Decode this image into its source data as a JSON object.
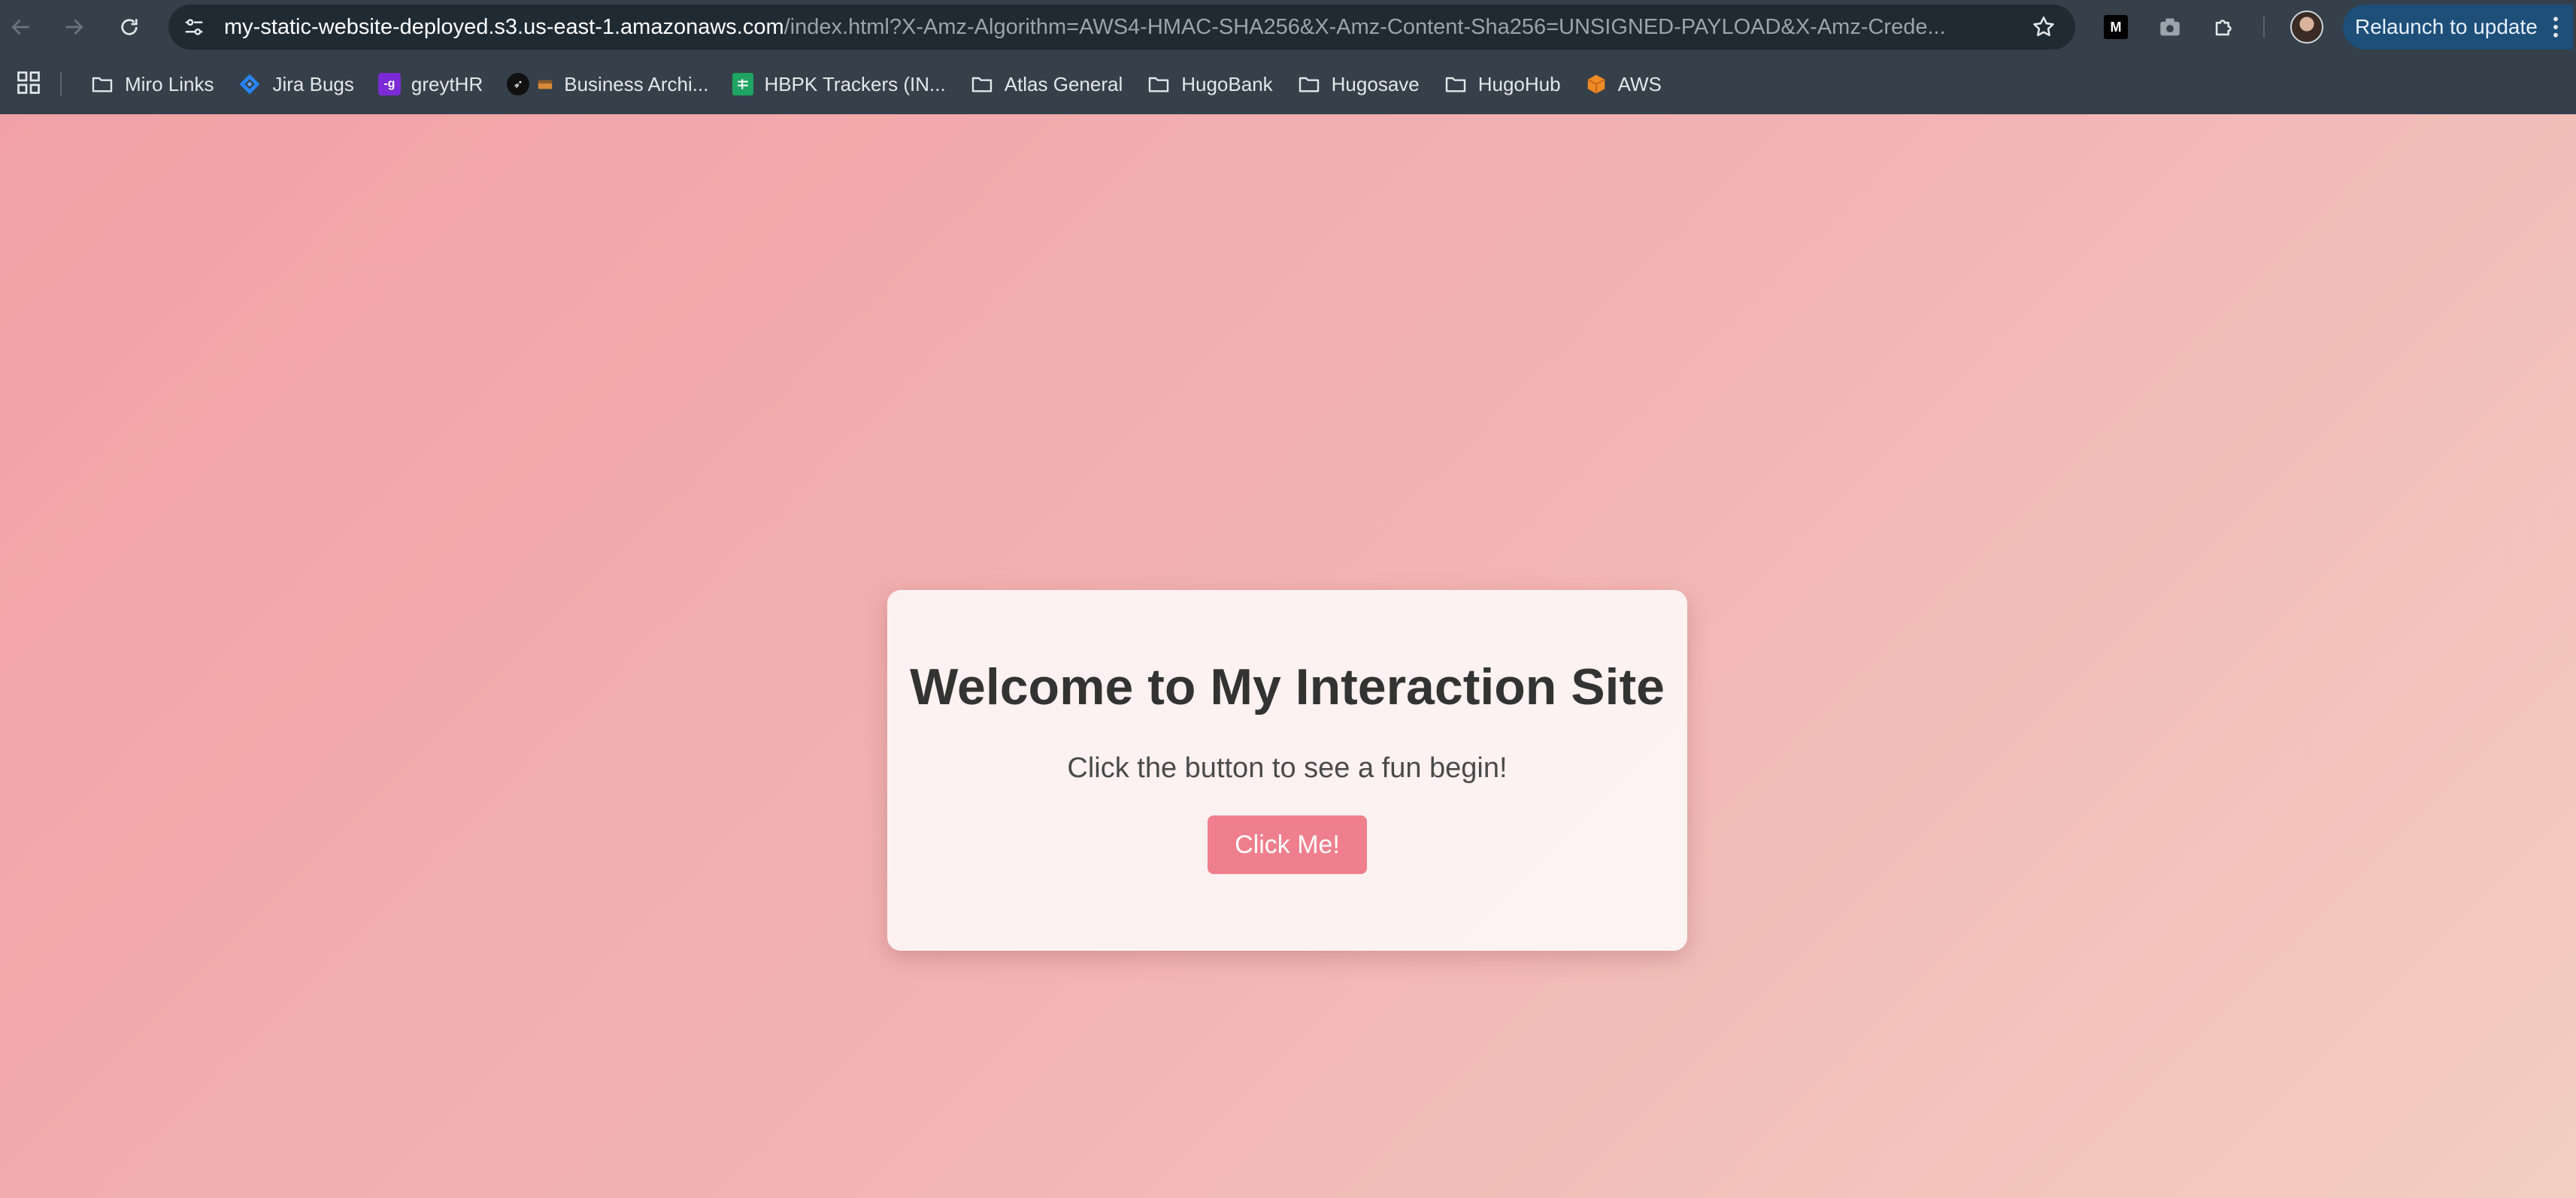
{
  "browser": {
    "url_host": "my-static-website-deployed.s3.us-east-1.amazonaws.com",
    "url_rest": "/index.html?X-Amz-Algorithm=AWS4-HMAC-SHA256&X-Amz-Content-Sha256=UNSIGNED-PAYLOAD&X-Amz-Crede...",
    "relaunch_label": "Relaunch to update",
    "extension_m_label": "M"
  },
  "bookmarks": [
    {
      "label": "Miro Links",
      "icon": "folder-icon"
    },
    {
      "label": "Jira Bugs",
      "icon": "jira-icon"
    },
    {
      "label": "greytHR",
      "icon": "greythr-icon"
    },
    {
      "label": "Business Archi...",
      "icon": "rocket-icon"
    },
    {
      "label": "HBPK Trackers (IN...",
      "icon": "sheets-icon"
    },
    {
      "label": "Atlas General",
      "icon": "folder-icon"
    },
    {
      "label": "HugoBank",
      "icon": "folder-icon"
    },
    {
      "label": "Hugosave",
      "icon": "folder-icon"
    },
    {
      "label": "HugoHub",
      "icon": "folder-icon"
    },
    {
      "label": "AWS",
      "icon": "aws-icon"
    }
  ],
  "page": {
    "heading": "Welcome to My Interaction Site",
    "subtitle": "Click the button to see a fun begin!",
    "button_label": "Click Me!"
  },
  "colors": {
    "toolbar": "#35404a",
    "omnibox": "#202a32",
    "relaunch_bg": "#1d4f79",
    "button": "#ef7f8d",
    "background_start": "#f1a1a5",
    "background_end": "#f3cdc2"
  }
}
